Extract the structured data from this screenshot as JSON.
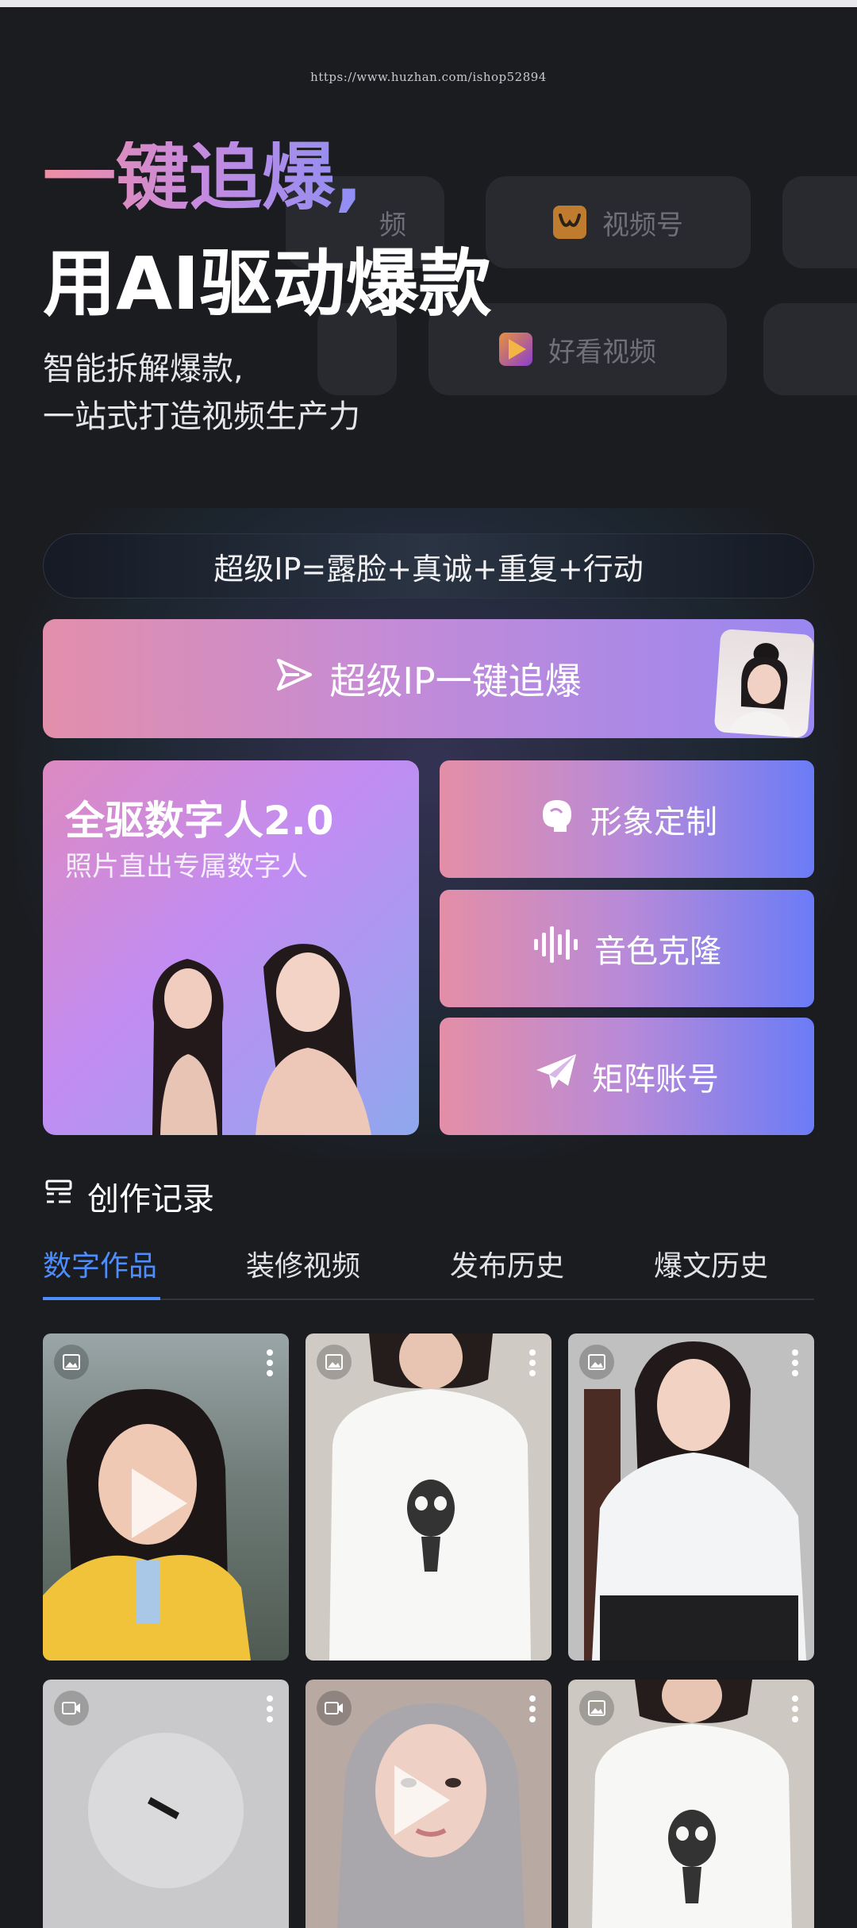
{
  "watermark": "https://www.huzhan.com/ishop52894",
  "platforms": [
    {
      "label": "频",
      "icon": "none"
    },
    {
      "label": "视频号",
      "icon": "channels-logo-icon",
      "color": "#f0a43a"
    },
    {
      "label": "好看视频",
      "icon": "haokan-logo-icon",
      "color": "#e5573f"
    }
  ],
  "hero": {
    "line1": "一键追爆,",
    "line2": "用AI驱动爆款",
    "sub1": "智能拆解爆款,",
    "sub2": "一站式打造视频生产力"
  },
  "formula": "超级IP=露脸+真诚+重复+行动",
  "main_action": {
    "label": "超级IP一键追爆",
    "icon": "send-icon"
  },
  "digital_human": {
    "title": "全驱数字人2.0",
    "subtitle": "照片直出专属数字人"
  },
  "features": [
    {
      "label": "形象定制",
      "icon": "profile-head-icon"
    },
    {
      "label": "音色克隆",
      "icon": "sound-wave-icon"
    },
    {
      "label": "矩阵账号",
      "icon": "paper-plane-icon"
    }
  ],
  "records": {
    "title": "创作记录",
    "tabs": [
      {
        "label": "数字作品",
        "active": true
      },
      {
        "label": "装修视频",
        "active": false
      },
      {
        "label": "发布历史",
        "active": false
      },
      {
        "label": "爆文历史",
        "active": false
      }
    ]
  },
  "works": [
    {
      "type": "image",
      "subject": "girl in yellow shirt"
    },
    {
      "type": "image",
      "subject": "white skull t-shirt"
    },
    {
      "type": "image",
      "subject": "woman in white shirt on chair"
    },
    {
      "type": "video",
      "subject": "loading placeholder"
    },
    {
      "type": "video",
      "subject": "woman with silver hair"
    },
    {
      "type": "image",
      "subject": "white skull t-shirt"
    }
  ],
  "colors": {
    "accent": "#4c8dff",
    "background": "#1b1c20"
  }
}
